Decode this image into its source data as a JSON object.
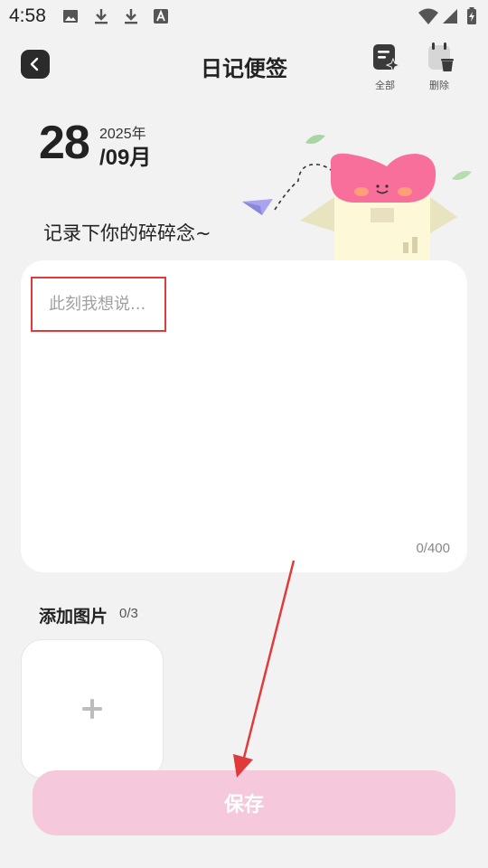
{
  "status_bar": {
    "time": "4:58",
    "icons": [
      "image-icon",
      "download-icon",
      "download-icon",
      "font-icon",
      "wifi-icon",
      "signal-icon",
      "battery-charging-icon"
    ]
  },
  "header": {
    "title": "日记便签",
    "all_label": "全部",
    "delete_label": "删除"
  },
  "date": {
    "day": "28",
    "year": "2025年",
    "month": "/09月"
  },
  "prompt": "记录下你的碎碎念~",
  "editor": {
    "placeholder": "此刻我想说...",
    "value": "",
    "char_count": "0/400"
  },
  "images": {
    "title": "添加图片",
    "count": "0/3"
  },
  "save_label": "保存",
  "colors": {
    "accent_pink": "#f5c8dc",
    "highlight_red": "#e03a3a"
  }
}
